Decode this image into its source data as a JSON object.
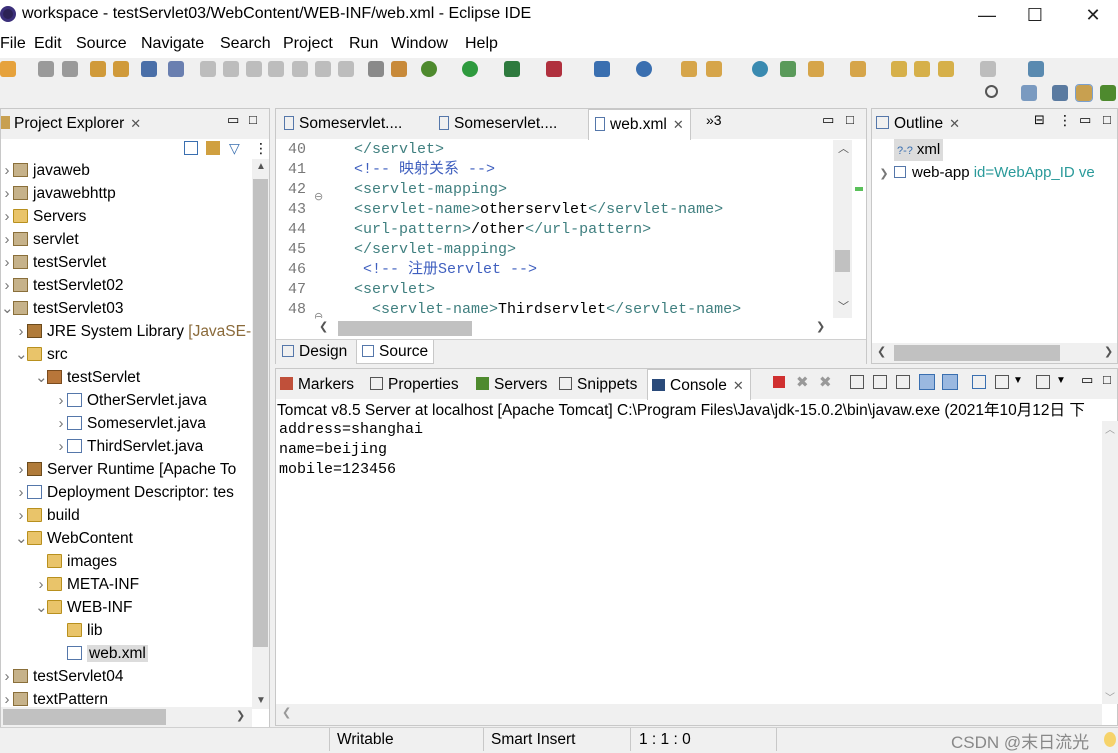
{
  "window": {
    "title": "workspace - testServlet03/WebContent/WEB-INF/web.xml - Eclipse IDE",
    "minimize": "—",
    "maximize": "☐",
    "close": "✕"
  },
  "menu": [
    "File",
    "Edit",
    "Source",
    "Navigate",
    "Search",
    "Project",
    "Run",
    "Window",
    "Help"
  ],
  "project_explorer": {
    "title": "Project Explorer",
    "items": [
      {
        "label": "javaweb",
        "depth": 0,
        "icon": "project-icon",
        "expanded": false
      },
      {
        "label": "javawebhttp",
        "depth": 0,
        "icon": "project-icon",
        "expanded": false
      },
      {
        "label": "Servers",
        "depth": 0,
        "icon": "folder-icon",
        "expanded": false
      },
      {
        "label": "servlet",
        "depth": 0,
        "icon": "project-icon",
        "expanded": false
      },
      {
        "label": "testServlet",
        "depth": 0,
        "icon": "project-icon",
        "expanded": false
      },
      {
        "label": "testServlet02",
        "depth": 0,
        "icon": "project-icon",
        "expanded": false
      },
      {
        "label": "testServlet03",
        "depth": 0,
        "icon": "project-icon",
        "expanded": true
      },
      {
        "label": "JRE System Library",
        "suffix": " [JavaSE-",
        "depth": 1,
        "icon": "library-icon",
        "expanded": false
      },
      {
        "label": "src",
        "depth": 1,
        "icon": "folder-icon",
        "expanded": true
      },
      {
        "label": "testServlet",
        "depth": 2,
        "icon": "package-icon",
        "expanded": true
      },
      {
        "label": "OtherServlet.java",
        "depth": 3,
        "icon": "java-file-icon",
        "expanded": false
      },
      {
        "label": "Someservlet.java",
        "depth": 3,
        "icon": "java-file-icon",
        "expanded": false
      },
      {
        "label": "ThirdServlet.java",
        "depth": 3,
        "icon": "java-file-icon",
        "expanded": false
      },
      {
        "label": "Server Runtime [Apache To",
        "depth": 1,
        "icon": "library-icon",
        "expanded": false
      },
      {
        "label": "Deployment Descriptor: tes",
        "depth": 1,
        "icon": "descriptor-icon",
        "expanded": false
      },
      {
        "label": "build",
        "depth": 1,
        "icon": "folder-icon",
        "expanded": false
      },
      {
        "label": "WebContent",
        "depth": 1,
        "icon": "folder-icon",
        "expanded": true
      },
      {
        "label": "images",
        "depth": 2,
        "icon": "folder-icon",
        "expanded": null
      },
      {
        "label": "META-INF",
        "depth": 2,
        "icon": "folder-icon",
        "expanded": false
      },
      {
        "label": "WEB-INF",
        "depth": 2,
        "icon": "folder-icon",
        "expanded": true
      },
      {
        "label": "lib",
        "depth": 3,
        "icon": "folder-icon",
        "expanded": null
      },
      {
        "label": "web.xml",
        "depth": 3,
        "icon": "xml-file-icon",
        "expanded": null,
        "selected": true
      },
      {
        "label": "testServlet04",
        "depth": 0,
        "icon": "project-icon",
        "expanded": false
      },
      {
        "label": "textPattern",
        "depth": 0,
        "icon": "project-icon",
        "expanded": false
      }
    ]
  },
  "editor": {
    "tabs": [
      {
        "label": "Someservlet....",
        "active": false
      },
      {
        "label": "Someservlet....",
        "active": false
      },
      {
        "label": "web.xml",
        "active": true
      }
    ],
    "overflow": "»3",
    "lines": [
      {
        "n": "40",
        "html": "  <span class='tag'>&lt;/servlet&gt;</span>"
      },
      {
        "n": "41",
        "html": "  <span class='cmt'>&lt;!-- 映射关系 --&gt;</span>"
      },
      {
        "n": "42",
        "html": "  <span class='tag'>&lt;servlet-mapping&gt;</span>"
      },
      {
        "n": "43",
        "html": "  <span class='tag'>&lt;servlet-name&gt;</span><span class='txt'>otherservlet</span><span class='tag'>&lt;/servlet-name&gt;</span>"
      },
      {
        "n": "44",
        "html": "  <span class='tag'>&lt;url-pattern&gt;</span><span class='txt'>/other</span><span class='tag'>&lt;/url-pattern&gt;</span>"
      },
      {
        "n": "45",
        "html": "  <span class='tag'>&lt;/servlet-mapping&gt;</span>"
      },
      {
        "n": "46",
        "html": "   <span class='cmt'>&lt;!-- 注册Servlet --&gt;</span>"
      },
      {
        "n": "47",
        "html": "  <span class='tag'>&lt;servlet&gt;</span>"
      },
      {
        "n": "48",
        "html": "    <span class='tag'>&lt;servlet-name&gt;</span><span class='txt'>Thirdservlet</span><span class='tag'>&lt;/servlet-name&gt;</span>"
      }
    ],
    "bottom_tabs": [
      "Design",
      "Source"
    ]
  },
  "outline": {
    "title": "Outline",
    "items": [
      {
        "label": "xml",
        "prefix": "?-?"
      },
      {
        "label": "web-app",
        "attr": " id=WebApp_ID ve"
      }
    ]
  },
  "bottom_tabs": [
    "Markers",
    "Properties",
    "Servers",
    "Snippets",
    "Console"
  ],
  "console": {
    "header": "Tomcat v8.5 Server at localhost [Apache Tomcat] C:\\Program Files\\Java\\jdk-15.0.2\\bin\\javaw.exe  (2021年10月12日 下",
    "lines": [
      "address=shanghai",
      "name=beijing",
      "mobile=123456"
    ]
  },
  "status": {
    "writable": "Writable",
    "insert_mode": "Smart Insert",
    "position": "1 : 1 : 0",
    "watermark": "CSDN @末日流光"
  }
}
